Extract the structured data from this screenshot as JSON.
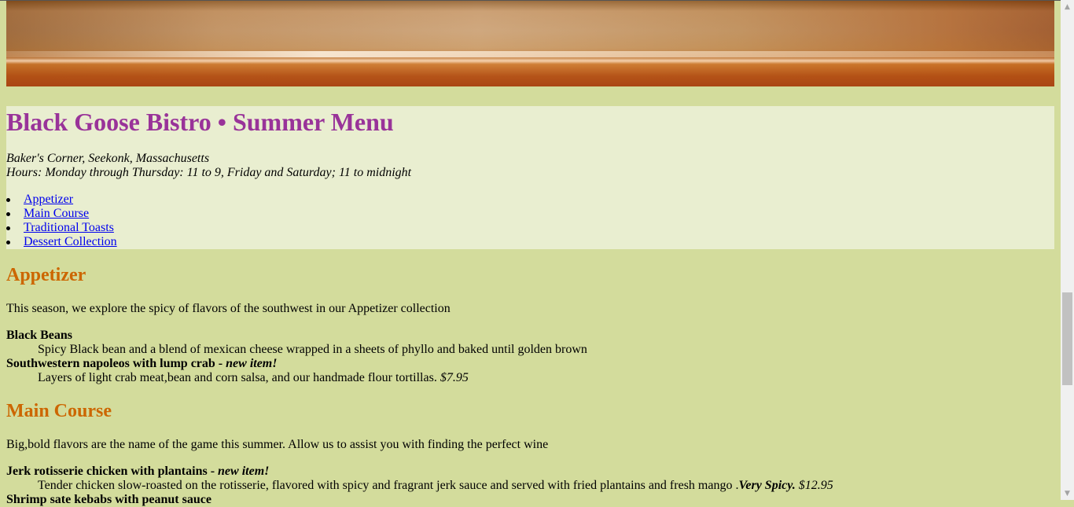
{
  "header": {
    "title": "Black Goose Bistro • Summer Menu",
    "address_line1": "Baker's Corner, Seekonk, Massachusetts",
    "address_line2": "Hours: Monday through Thursday: 11 to 9, Friday and Saturday; 11 to midnight",
    "nav": [
      "Appetizer",
      "Main Course",
      "Traditional Toasts",
      "Dessert Collection"
    ]
  },
  "appetizer": {
    "heading": "Appetizer",
    "intro": "This season, we explore the spicy of flavors of the southwest in our Appetizer collection",
    "item1_name": "Black Beans",
    "item1_desc": "Spicy Black bean and a blend of mexican cheese wrapped in a sheets of phyllo and baked until golden brown",
    "item2_name": "Southwestern napoleos with lump crab - ",
    "item2_new": "new item!",
    "item2_desc": "Layers of light crab meat,bean and corn salsa, and our handmade flour tortillas. ",
    "item2_price": "$7.95"
  },
  "main_course": {
    "heading": "Main Course",
    "intro": "Big,bold flavors are the name of the game this summer. Allow us to assist you with finding the perfect wine",
    "item1_name": "Jerk rotisserie chicken with plantains - ",
    "item1_new": "new item!",
    "item1_desc": "Tender chicken slow-roasted on the rotisserie, flavored with spicy and fragrant jerk sauce and served with fried plantains and fresh mango .",
    "item1_spicy": "Very Spicy.",
    "item1_price": " $12.95",
    "item2_name": "Shrimp sate kebabs with peanut sauce"
  },
  "colors": {
    "page_bg": "#d3dc9c",
    "header_bg": "#e9eed0",
    "title": "#993399",
    "heading": "#cc6600",
    "link": "#0000ee"
  },
  "scrollbar": {
    "up_icon": "▲",
    "down_icon": "▼"
  }
}
